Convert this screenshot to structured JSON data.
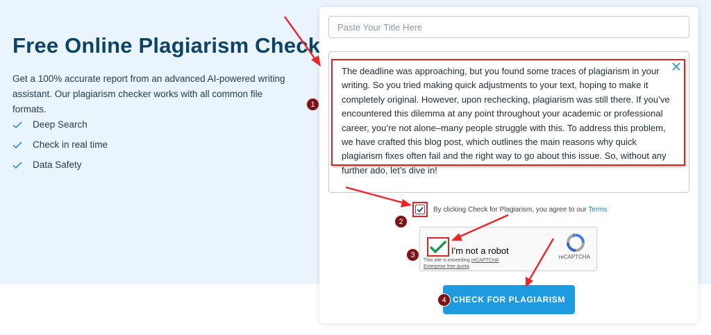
{
  "hero": {
    "title": "Free Online Plagiarism Checker",
    "subtitle": "Get a 100% accurate report from an advanced AI-powered writing assistant. Our plagiarism checker works with all common file formats.",
    "features": [
      "Deep Search",
      "Check in real time",
      "Data Safety"
    ]
  },
  "form": {
    "title_placeholder": "Paste Your Title Here",
    "text_content": "The deadline was approaching, but you found some traces of plagiarism in your writing. So you tried making quick adjustments to your text, hoping to make it completely original. However, upon rechecking, plagiarism was still there. If you’ve encountered this dilemma at any point throughout your academic or professional career, you’re not alone–many people struggle with this. To address this problem, we have crafted this blog post, which outlines the main reasons why quick plagiarism fixes often fail and the right way to go about this issue. So, without any further ado, let’s dive in!",
    "terms_text": "By clicking Check for Plagiarism, you agree to our ",
    "terms_link": "Terms",
    "terms_checked": true,
    "check_button": "CHECK FOR PLAGIARISM"
  },
  "recaptcha": {
    "label": "I'm not a robot",
    "note_prefix": "This site is exceeding ",
    "note_link": "reCAPTCHA Enterprise free quota",
    "note_suffix": ".",
    "brand": "reCAPTCHA"
  },
  "annotations": {
    "badges": [
      "1",
      "2",
      "3",
      "4"
    ],
    "arrow_color": "#e8262b",
    "badge_color": "#7c1316"
  },
  "colors": {
    "hero_background": "#eaf4fc",
    "title": "#0d4466",
    "accent": "#1e9be0",
    "highlight_border": "#d9232b"
  }
}
